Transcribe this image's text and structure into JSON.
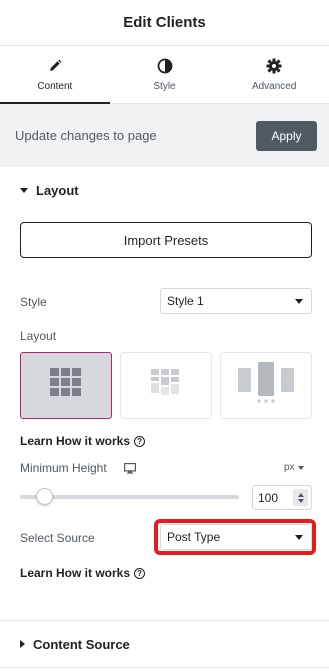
{
  "header": {
    "title": "Edit Clients"
  },
  "tabs": [
    {
      "label": "Content",
      "icon": "pencil-icon",
      "active": true
    },
    {
      "label": "Style",
      "icon": "half-circle-icon",
      "active": false
    },
    {
      "label": "Advanced",
      "icon": "gear-icon",
      "active": false
    }
  ],
  "update": {
    "text": "Update changes to page",
    "apply_label": "Apply"
  },
  "layout_section": {
    "title": "Layout",
    "import_label": "Import Presets",
    "style_label": "Style",
    "style_value": "Style 1",
    "layout_label": "Layout",
    "layout_options": [
      {
        "icon": "grid-layout-icon",
        "selected": true
      },
      {
        "icon": "masonry-layout-icon",
        "selected": false
      },
      {
        "icon": "carousel-layout-icon",
        "selected": false
      }
    ],
    "learn_label": "Learn How it works",
    "min_height_label": "Minimum Height",
    "min_height_unit": "px",
    "min_height_value": "100",
    "slider_fraction": 0.08,
    "source_label": "Select Source",
    "source_value": "Post Type",
    "learn_label_2": "Learn How it works"
  },
  "content_source": {
    "title": "Content Source"
  },
  "colors": {
    "accent": "#b3246f",
    "highlight": "#e31c1c",
    "apply_bg": "#515962"
  }
}
